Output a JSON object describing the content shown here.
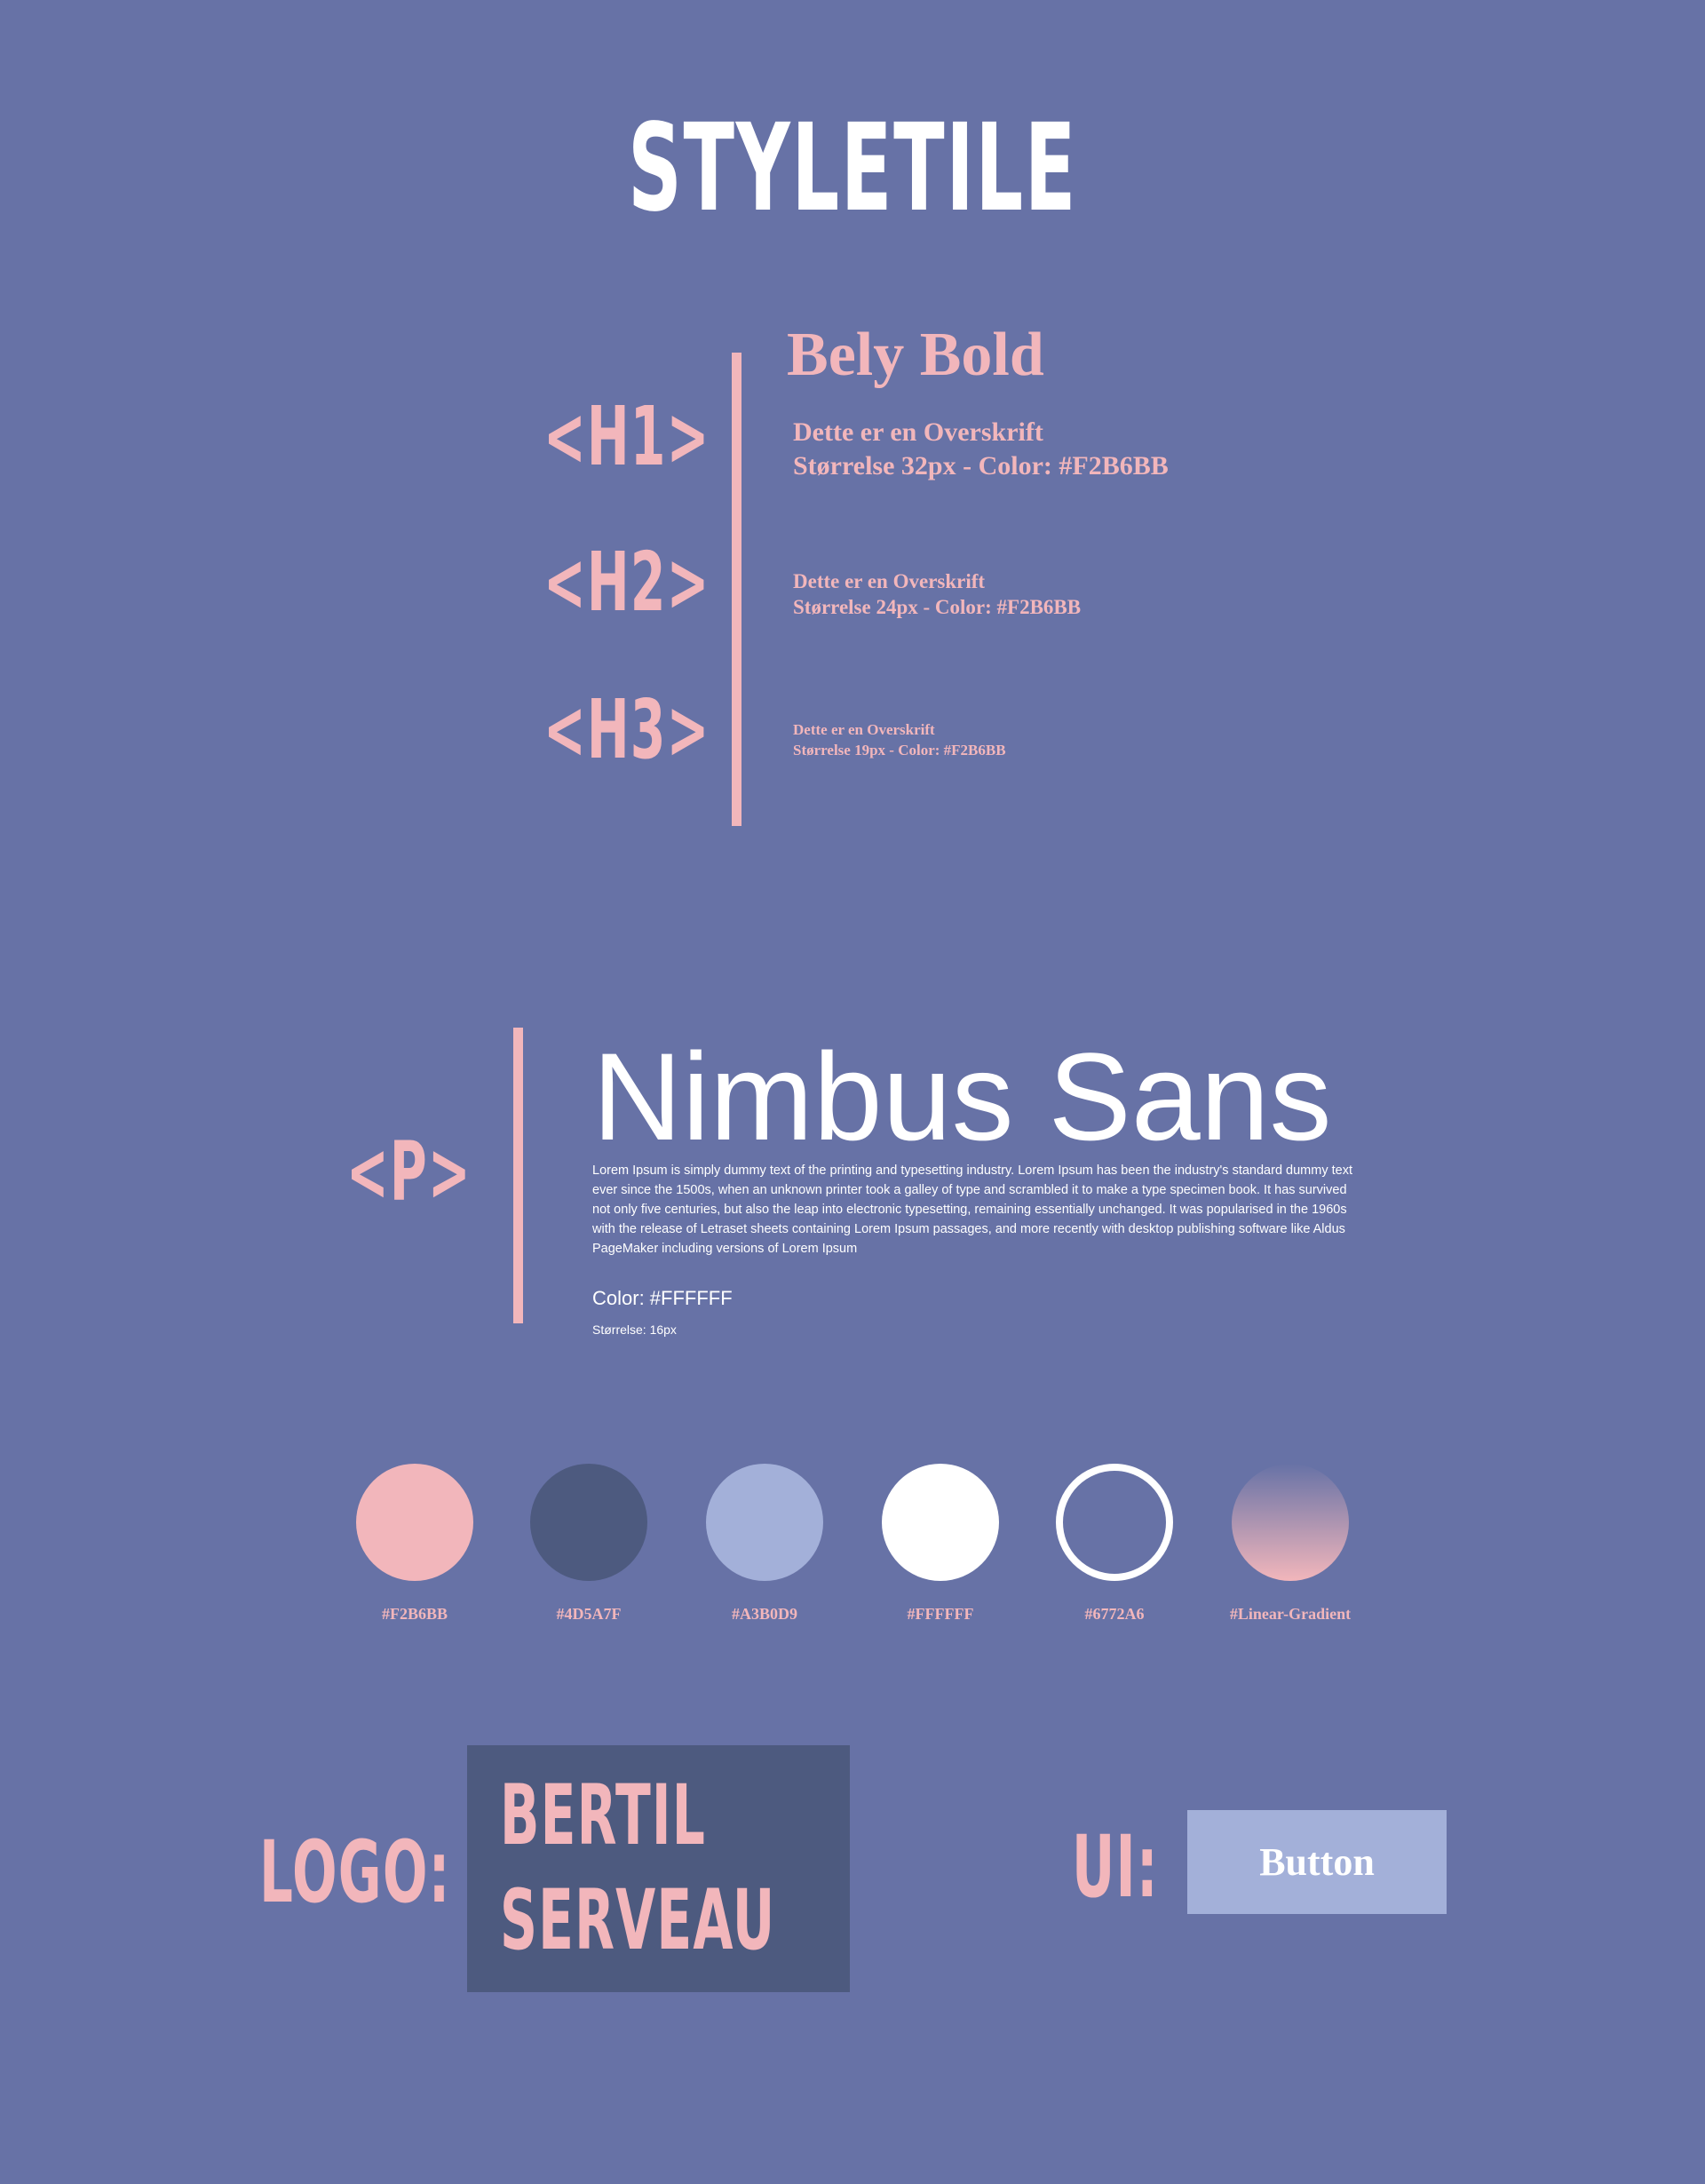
{
  "page": {
    "title": "STYLETILE"
  },
  "headings": {
    "font_name": "Bely Bold",
    "h1": {
      "tag": "<H1>",
      "line1": "Dette er en Overskrift",
      "line2": "Størrelse 32px - Color: #F2B6BB"
    },
    "h2": {
      "tag": "<H2>",
      "line1": "Dette er en Overskrift",
      "line2": "Størrelse 24px - Color: #F2B6BB"
    },
    "h3": {
      "tag": "<H3>",
      "line1": "Dette er en Overskrift",
      "line2": "Størrelse 19px - Color: #F2B6BB"
    }
  },
  "paragraph": {
    "tag": "<P>",
    "font_name": "Nimbus Sans",
    "body": "Lorem Ipsum is simply dummy text of the printing and typesetting industry. Lorem Ipsum has been the industry's standard dummy text ever since the 1500s, when an unknown printer took a galley of type and scrambled it to make a type specimen book. It has survived not only five centuries, but also the leap into electronic typesetting, remaining essentially unchanged. It was popularised in the 1960s with the release of Letraset sheets containing Lorem Ipsum passages, and more recently with desktop publishing software like Aldus PageMaker including versions of Lorem Ipsum",
    "color_label": "Color: #FFFFFF",
    "size_label": "Størrelse: 16px"
  },
  "palette": [
    {
      "label": "#F2B6BB",
      "color": "#F2B6BB"
    },
    {
      "label": "#4D5A7F",
      "color": "#4D5A7F"
    },
    {
      "label": "#A3B0D9",
      "color": "#A3B0D9"
    },
    {
      "label": "#FFFFFF",
      "color": "#FFFFFF"
    },
    {
      "label": "#6772A6",
      "color": "#6772A6"
    },
    {
      "label": "#Linear-Gradient",
      "color": "#6772A6",
      "color_end": "#F2B6BB"
    }
  ],
  "logo": {
    "label": "LOGO:",
    "line1": "BERTIL",
    "line2": "SERVEAU"
  },
  "ui": {
    "label": "UI:",
    "button_label": "Button"
  },
  "colors": {
    "background": "#6772A6",
    "accent": "#F2B6BB",
    "dark": "#4D5A7F",
    "light": "#A3B0D9",
    "white": "#FFFFFF"
  }
}
